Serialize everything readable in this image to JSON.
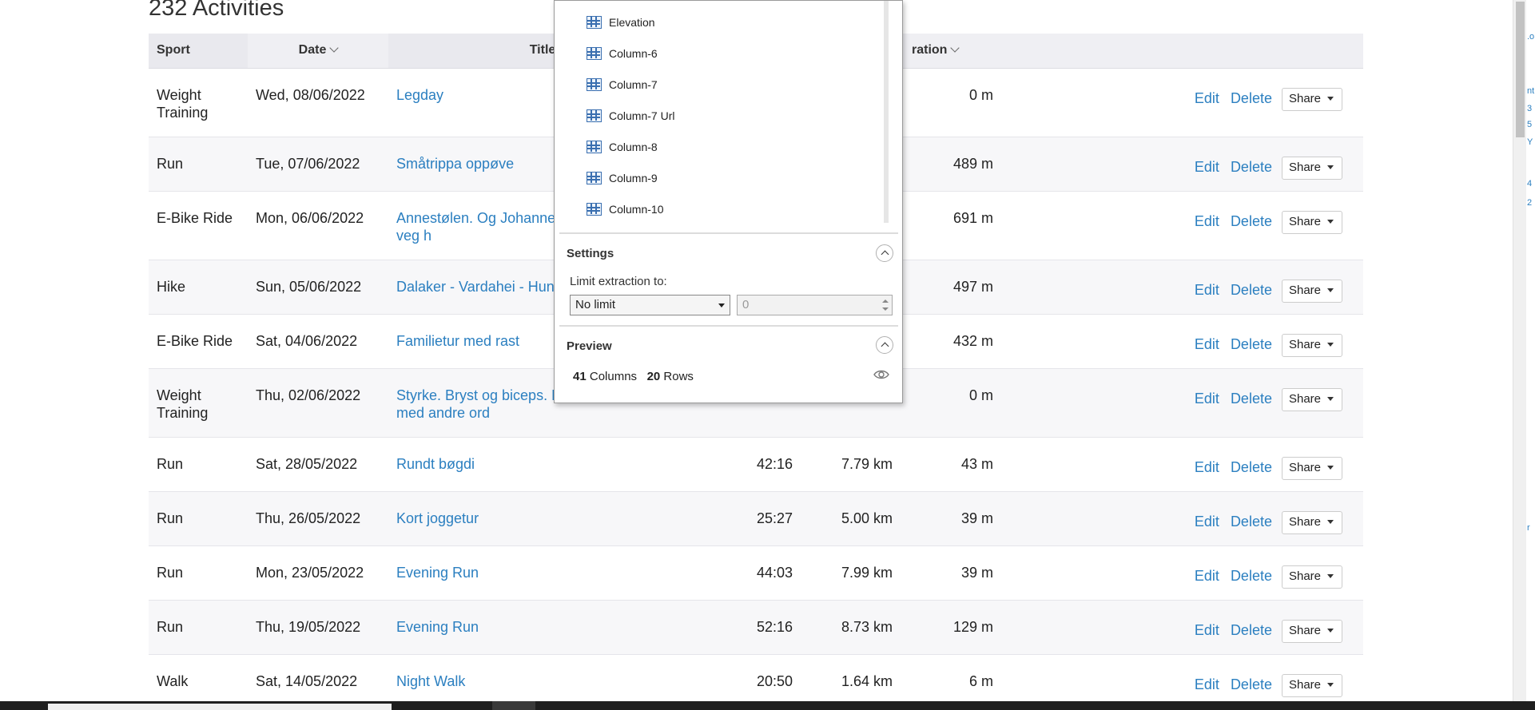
{
  "page": {
    "heading": "232 Activities",
    "columns": {
      "sport": "Sport",
      "date": "Date",
      "title": "Title",
      "elevation_partial": "ration"
    }
  },
  "activities": [
    {
      "sport": "Weight Training",
      "date": "Wed, 08/06/2022",
      "title": "Legday",
      "time": "",
      "distance": "",
      "elevation": "0 m"
    },
    {
      "sport": "Run",
      "date": "Tue, 07/06/2022",
      "title": "Småtrippa oppøve",
      "time": "",
      "distance": "",
      "elevation": "489 m"
    },
    {
      "sport": "E-Bike Ride",
      "date": "Mon, 06/06/2022",
      "title": "Annestølen. Og Johannes innom te mø'en på veg h",
      "time": "",
      "distance": "",
      "elevation": "691 m"
    },
    {
      "sport": "Hike",
      "date": "Sun, 05/06/2022",
      "title": "Dalaker - Vardahei - Hun",
      "time": "",
      "distance": "",
      "elevation": "497 m"
    },
    {
      "sport": "E-Bike Ride",
      "date": "Sat, 04/06/2022",
      "title": "Familietur med rast",
      "time": "",
      "distance": "",
      "elevation": "432 m"
    },
    {
      "sport": "Weight Training",
      "date": "Thu, 02/06/2022",
      "title": "Styrke. Bryst og biceps. Kjernemuskulaturen med andre ord",
      "time": "",
      "distance": "",
      "elevation": "0 m"
    },
    {
      "sport": "Run",
      "date": "Sat, 28/05/2022",
      "title": "Rundt bøgdi",
      "time": "42:16",
      "distance": "7.79 km",
      "elevation": "43 m"
    },
    {
      "sport": "Run",
      "date": "Thu, 26/05/2022",
      "title": "Kort joggetur",
      "time": "25:27",
      "distance": "5.00 km",
      "elevation": "39 m"
    },
    {
      "sport": "Run",
      "date": "Mon, 23/05/2022",
      "title": "Evening Run",
      "time": "44:03",
      "distance": "7.99 km",
      "elevation": "39 m"
    },
    {
      "sport": "Run",
      "date": "Thu, 19/05/2022",
      "title": "Evening Run",
      "time": "52:16",
      "distance": "8.73 km",
      "elevation": "129 m"
    },
    {
      "sport": "Walk",
      "date": "Sat, 14/05/2022",
      "title": "Night Walk",
      "time": "20:50",
      "distance": "1.64 km",
      "elevation": "6 m"
    }
  ],
  "row_actions": {
    "edit": "Edit",
    "delete": "Delete",
    "share": "Share"
  },
  "extraction_panel": {
    "columns": [
      "Elevation",
      "Column-6",
      "Column-7",
      "Column-7 Url",
      "Column-8",
      "Column-9",
      "Column-10"
    ],
    "settings_title": "Settings",
    "limit_label": "Limit extraction to:",
    "limit_select": "No limit",
    "limit_value": "0",
    "preview_title": "Preview",
    "preview_columns_count": "41",
    "preview_columns_label": "Columns",
    "preview_rows_count": "20",
    "preview_rows_label": "Rows"
  },
  "right_edge_fragments": [
    ".o",
    "nt",
    "3",
    "5",
    "Y",
    "4",
    "2",
    "r"
  ],
  "colors": {
    "link": "#2b7fc0",
    "header_bg": "#efeff3",
    "alt_row_bg": "#f7f7f9",
    "frame_accent": "#e0303c",
    "column_icon": "#3a6fb0"
  },
  "icons": [
    "sort-chevron-icon",
    "share-caret-icon",
    "column-table-icon",
    "collapse-chevron-icon",
    "eye-icon",
    "select-caret-icon",
    "spinner-icon"
  ]
}
